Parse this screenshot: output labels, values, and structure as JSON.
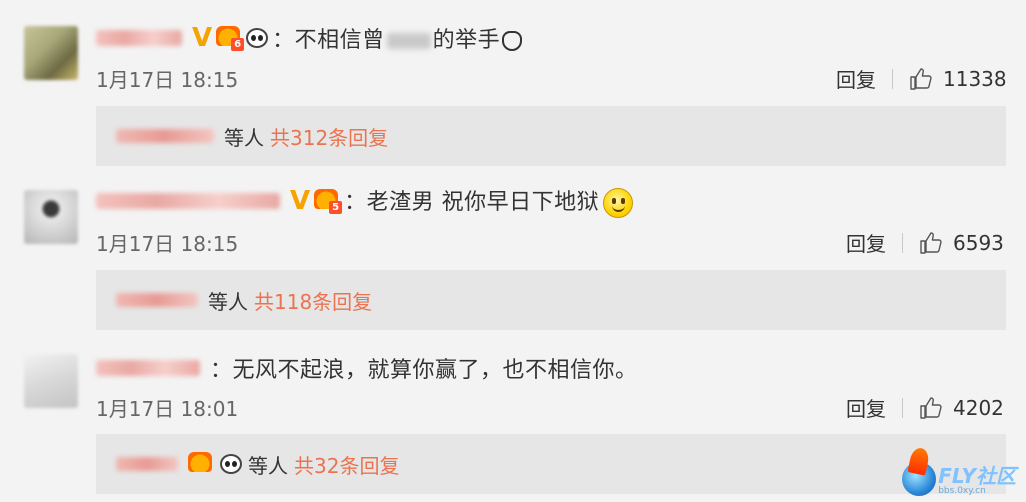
{
  "comments": [
    {
      "text_before": "：不相信曾",
      "text_after": "的举手",
      "time": "1月17日 18:15",
      "reply_label": "回复",
      "like_count": "11338",
      "replies": {
        "etc": "等人",
        "total": "共312条回复"
      }
    },
    {
      "text": "：老渣男 祝你早日下地狱",
      "time": "1月17日 18:15",
      "reply_label": "回复",
      "like_count": "6593",
      "replies": {
        "etc": "等人",
        "total": "共118条回复"
      }
    },
    {
      "text": "：无风不起浪，就算你赢了，也不相信你。",
      "time": "1月17日 18:01",
      "reply_label": "回复",
      "like_count": "4202",
      "replies": {
        "etc": "等人",
        "total": "共32条回复"
      }
    }
  ],
  "badges": {
    "level1": "6",
    "level2": "5"
  },
  "colors": {
    "link": "#eb7350",
    "background": "#f3f3f3",
    "reply_box": "#e6e6e6",
    "verified": "#f4a300"
  },
  "icons": {
    "like": "thumbs-up-icon",
    "verified": "verified-v-icon",
    "panda": "panda-emoji-icon",
    "smile": "smile-emoji-icon"
  },
  "watermark": {
    "main": "FLY社区",
    "sub": "bbs.0xy.cn"
  }
}
